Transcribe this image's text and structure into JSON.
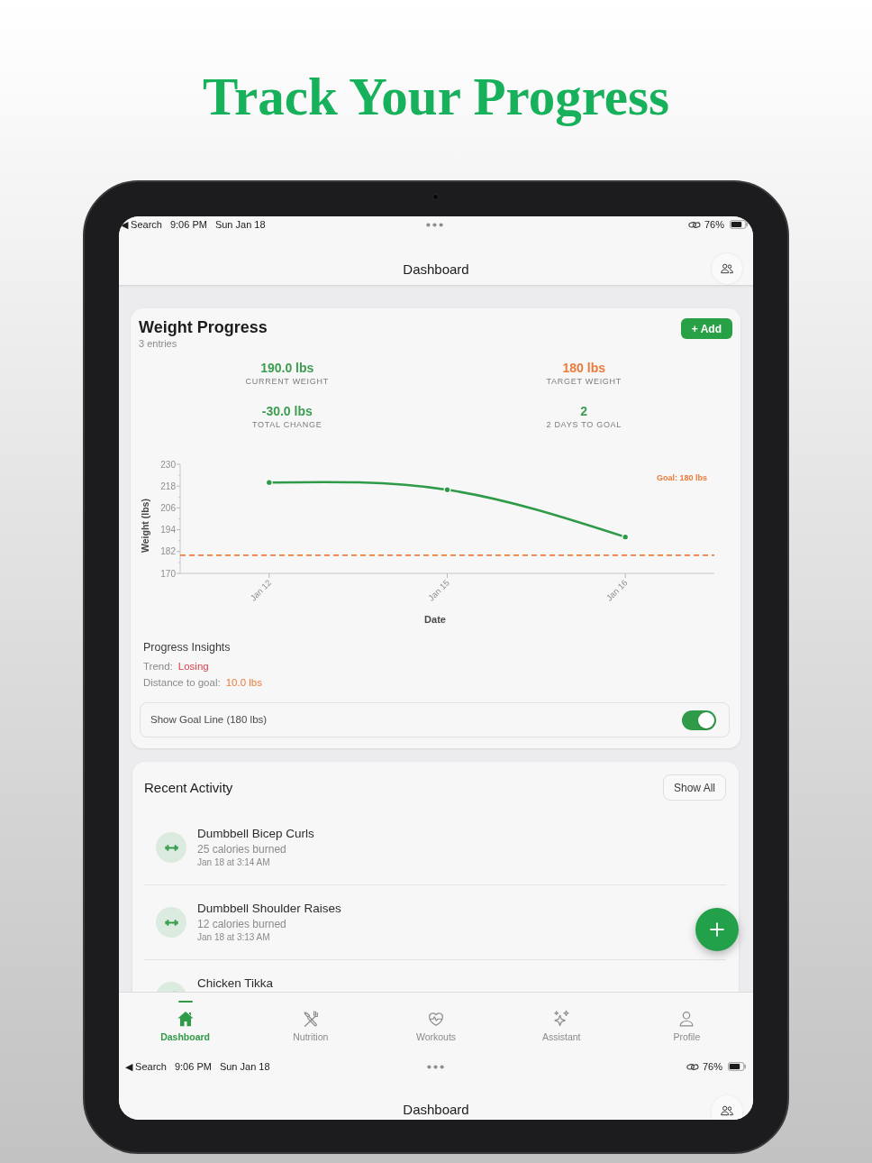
{
  "headline": "Track Your Progress",
  "status_bar": {
    "back_label": "◀ Search",
    "time": "9:06 PM",
    "date": "Sun Jan 18",
    "battery": "76%"
  },
  "nav_bar": {
    "title": "Dashboard"
  },
  "weight_card": {
    "title": "Weight Progress",
    "subtitle": "3 entries",
    "add_button": "+ Add",
    "stats": [
      {
        "value": "190.0 lbs",
        "label": "CURRENT WEIGHT",
        "color": "#3b9e50"
      },
      {
        "value": "180 lbs",
        "label": "TARGET WEIGHT",
        "color": "#ee7a3a"
      },
      {
        "value": "-30.0 lbs",
        "label": "TOTAL CHANGE",
        "color": "#3b9e50"
      },
      {
        "value": "2",
        "label": "2 DAYS TO GOAL",
        "color": "#3b9e50"
      }
    ],
    "chart_data": {
      "type": "line",
      "xlabel": "Date",
      "ylabel": "Weight (lbs)",
      "categories": [
        "Jan 12",
        "Jan 15",
        "Jan 16"
      ],
      "values": [
        220,
        216,
        190
      ],
      "marker": true,
      "ylim": [
        170,
        230
      ],
      "yticks": [
        170,
        182,
        194,
        206,
        218,
        230
      ],
      "ref_lines": [
        {
          "axis": "y",
          "value": 180,
          "label": "Goal: 180 lbs"
        }
      ]
    },
    "insights": {
      "title": "Progress Insights",
      "rows": [
        {
          "label": "Trend:",
          "value": "Losing",
          "color": "#d8434b"
        },
        {
          "label": "Distance to goal:",
          "value": "10.0 lbs",
          "color": "#ee7a3a"
        }
      ]
    },
    "goal_toggle": {
      "label": "Show Goal Line (180 lbs)",
      "on": true
    }
  },
  "recent_activity": {
    "title": "Recent Activity",
    "show_all_button": "Show All",
    "items": [
      {
        "kind": "workout",
        "title": "Dumbbell Bicep Curls",
        "detail": "25 calories burned",
        "time": "Jan 18 at 3:14 AM"
      },
      {
        "kind": "workout",
        "title": "Dumbbell Shoulder Raises",
        "detail": "12 calories burned",
        "time": "Jan 18 at 3:13 AM"
      },
      {
        "kind": "meal",
        "title": "Chicken Tikka"
      }
    ]
  },
  "tab_bar": {
    "tabs": [
      {
        "kind": "home",
        "label": "Dashboard",
        "selected": true
      },
      {
        "kind": "nutrition",
        "label": "Nutrition",
        "selected": false
      },
      {
        "kind": "workouts",
        "label": "Workouts",
        "selected": false
      },
      {
        "kind": "assistant",
        "label": "Assistant",
        "selected": false
      },
      {
        "kind": "profile",
        "label": "Profile",
        "selected": false
      }
    ]
  },
  "bottom_status_bar": {
    "back_label": "◀ Search",
    "time": "9:06 PM",
    "date": "Sun Jan 18",
    "battery": "76%"
  },
  "bottom_nav_bar": {
    "title": "Dashboard"
  }
}
